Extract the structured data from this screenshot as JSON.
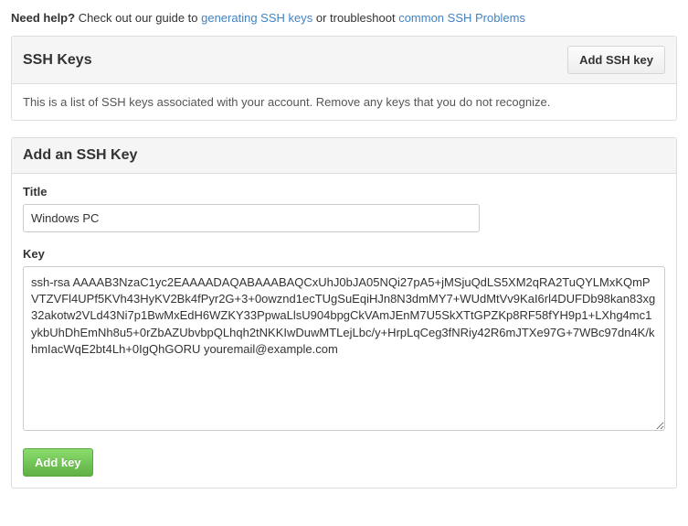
{
  "help": {
    "prefix_bold": "Need help?",
    "text1": " Check out our guide to ",
    "link1": "generating SSH keys",
    "text2": " or troubleshoot ",
    "link2": "common SSH Problems"
  },
  "ssh_keys_panel": {
    "title": "SSH Keys",
    "add_button": "Add SSH key",
    "description": "This is a list of SSH keys associated with your account. Remove any keys that you do not recognize."
  },
  "add_panel": {
    "title": "Add an SSH Key",
    "title_label": "Title",
    "title_value": "Windows PC",
    "key_label": "Key",
    "key_value": "ssh-rsa AAAAB3NzaC1yc2EAAAADAQABAAABAQCxUhJ0bJA05NQi27pA5+jMSjuQdLS5XM2qRA2TuQYLMxKQmPVTZVFl4UPf5KVh43HyKV2Bk4fPyr2G+3+0owznd1ecTUgSuEqiHJn8N3dmMY7+WUdMtVv9KaI6rl4DUFDb98kan83xg32akotw2VLd43Ni7p1BwMxEdH6WZKY33PpwaLlsU904bpgCkVAmJEnM7U5SkXTtGPZKp8RF58fYH9p1+LXhg4mc1ykbUhDhEmNh8u5+0rZbAZUbvbpQLhqh2tNKKIwDuwMTLejLbc/y+HrpLqCeg3fNRiy42R6mJTXe97G+7WBc97dn4K/khmIacWqE2bt4Lh+0IgQhGORU youremail@example.com",
    "submit_label": "Add key"
  }
}
